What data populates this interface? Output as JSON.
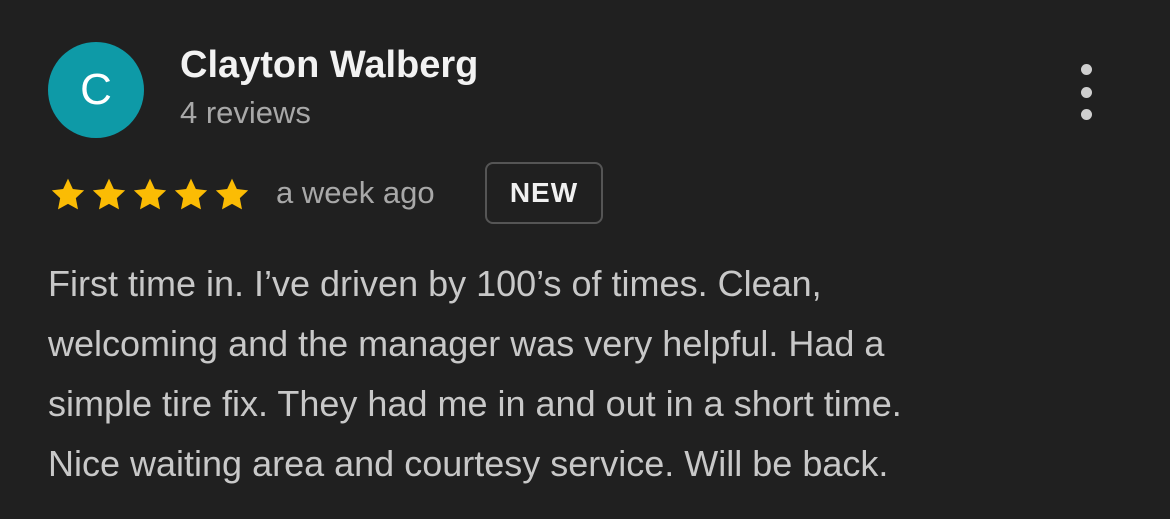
{
  "review": {
    "avatar_initial": "C",
    "avatar_color": "#0e9aa7",
    "reviewer_name": "Clayton Walberg",
    "reviewer_meta": "4 reviews",
    "rating": 5,
    "rating_max": 5,
    "star_color": "#fbbc04",
    "time_ago": "a week ago",
    "badge": "NEW",
    "text_lines": [
      "First time in. I’ve driven by 100’s of times. Clean,",
      "welcoming and the manager was very helpful. Had a",
      "simple tire fix. They had me in and out in a short time.",
      "Nice waiting area and courtesy service. Will be back."
    ],
    "more_icon": "more-vert-icon"
  }
}
